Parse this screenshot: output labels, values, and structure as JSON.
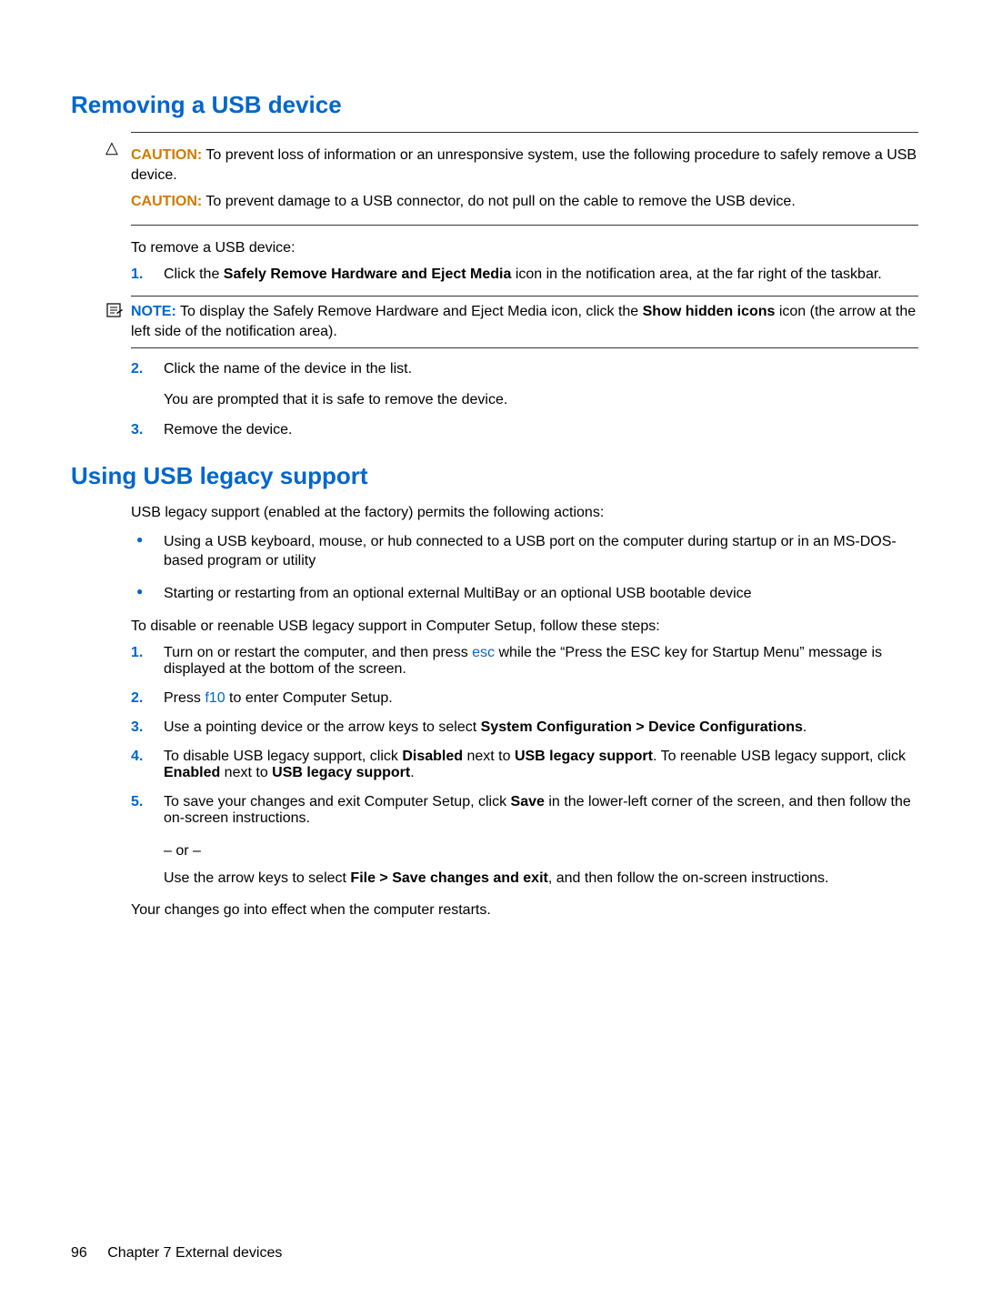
{
  "section1": {
    "heading": "Removing a USB device",
    "caution1": {
      "label": "CAUTION:",
      "text": "To prevent loss of information or an unresponsive system, use the following procedure to safely remove a USB device."
    },
    "caution2": {
      "label": "CAUTION:",
      "text": "To prevent damage to a USB connector, do not pull on the cable to remove the USB device."
    },
    "intro": "To remove a USB device:",
    "steps": {
      "s1": {
        "num": "1.",
        "pre": "Click the ",
        "bold": "Safely Remove Hardware and Eject Media",
        "post": " icon in the notification area, at the far right of the taskbar."
      },
      "note": {
        "label": "NOTE:",
        "pre": "To display the Safely Remove Hardware and Eject Media icon, click the ",
        "bold": "Show hidden icons",
        "post": " icon (the arrow at the left side of the notification area)."
      },
      "s2": {
        "num": "2.",
        "text": "Click the name of the device in the list.",
        "after": "You are prompted that it is safe to remove the device."
      },
      "s3": {
        "num": "3.",
        "text": "Remove the device."
      }
    }
  },
  "section2": {
    "heading": "Using USB legacy support",
    "intro": "USB legacy support (enabled at the factory) permits the following actions:",
    "bullets": {
      "b1": "Using a USB keyboard, mouse, or hub connected to a USB port on the computer during startup or in an MS-DOS-based program or utility",
      "b2": "Starting or restarting from an optional external MultiBay or an optional USB bootable device"
    },
    "intro2": "To disable or reenable USB legacy support in Computer Setup, follow these steps:",
    "steps": {
      "s1": {
        "num": "1.",
        "pre": "Turn on or restart the computer, and then press ",
        "key": "esc",
        "post": " while the “Press the ESC key for Startup Menu” message is displayed at the bottom of the screen."
      },
      "s2": {
        "num": "2.",
        "pre": "Press ",
        "key": "f10",
        "post": " to enter Computer Setup."
      },
      "s3": {
        "num": "3.",
        "pre": "Use a pointing device or the arrow keys to select ",
        "bold": "System Configuration > Device Configurations",
        "post": "."
      },
      "s4": {
        "num": "4.",
        "p1": "To disable USB legacy support, click ",
        "b1": "Disabled",
        "p2": " next to ",
        "b2": "USB legacy support",
        "p3": ". To reenable USB legacy support, click ",
        "b3": "Enabled",
        "p4": " next to ",
        "b4": "USB legacy support",
        "p5": "."
      },
      "s5": {
        "num": "5.",
        "p1": "To save your changes and exit Computer Setup, click ",
        "b1": "Save",
        "p2": " in the lower-left corner of the screen, and then follow the on-screen instructions.",
        "or": "– or –",
        "p3": "Use the arrow keys to select ",
        "b2": "File > Save changes and exit",
        "p4": ", and then follow the on-screen instructions."
      }
    },
    "closing": "Your changes go into effect when the computer restarts."
  },
  "footer": {
    "page": "96",
    "chapter": "Chapter 7   External devices"
  }
}
